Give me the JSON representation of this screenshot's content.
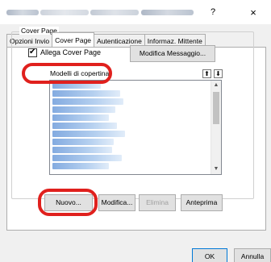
{
  "window": {
    "help_glyph": "?",
    "close_glyph": "×"
  },
  "tabs": [
    {
      "label": "Opzioni Invio"
    },
    {
      "label": "Cover Page"
    },
    {
      "label": "Autenticazione"
    },
    {
      "label": "Informaz. Mittente"
    }
  ],
  "cover_page": {
    "group_title": "Cover Page",
    "attach_label": "Allega Cover Page",
    "attach_checked": true,
    "check_glyph": "✔",
    "edit_message_button": "Modifica Messaggio...",
    "templates_label": "Modelli di copertina:",
    "sort_up_glyph": "⬆",
    "sort_down_glyph": "⬇",
    "scroll_up_glyph": "▲",
    "scroll_down_glyph": "▼",
    "new_button": "Nuovo...",
    "edit_button": "Modifica...",
    "delete_button": "Elimina",
    "preview_button": "Anteprima"
  },
  "footer": {
    "ok_button": "OK",
    "cancel_button": "Annulla"
  },
  "colors": {
    "highlight": "#e0201d",
    "accent": "#0078d7"
  }
}
